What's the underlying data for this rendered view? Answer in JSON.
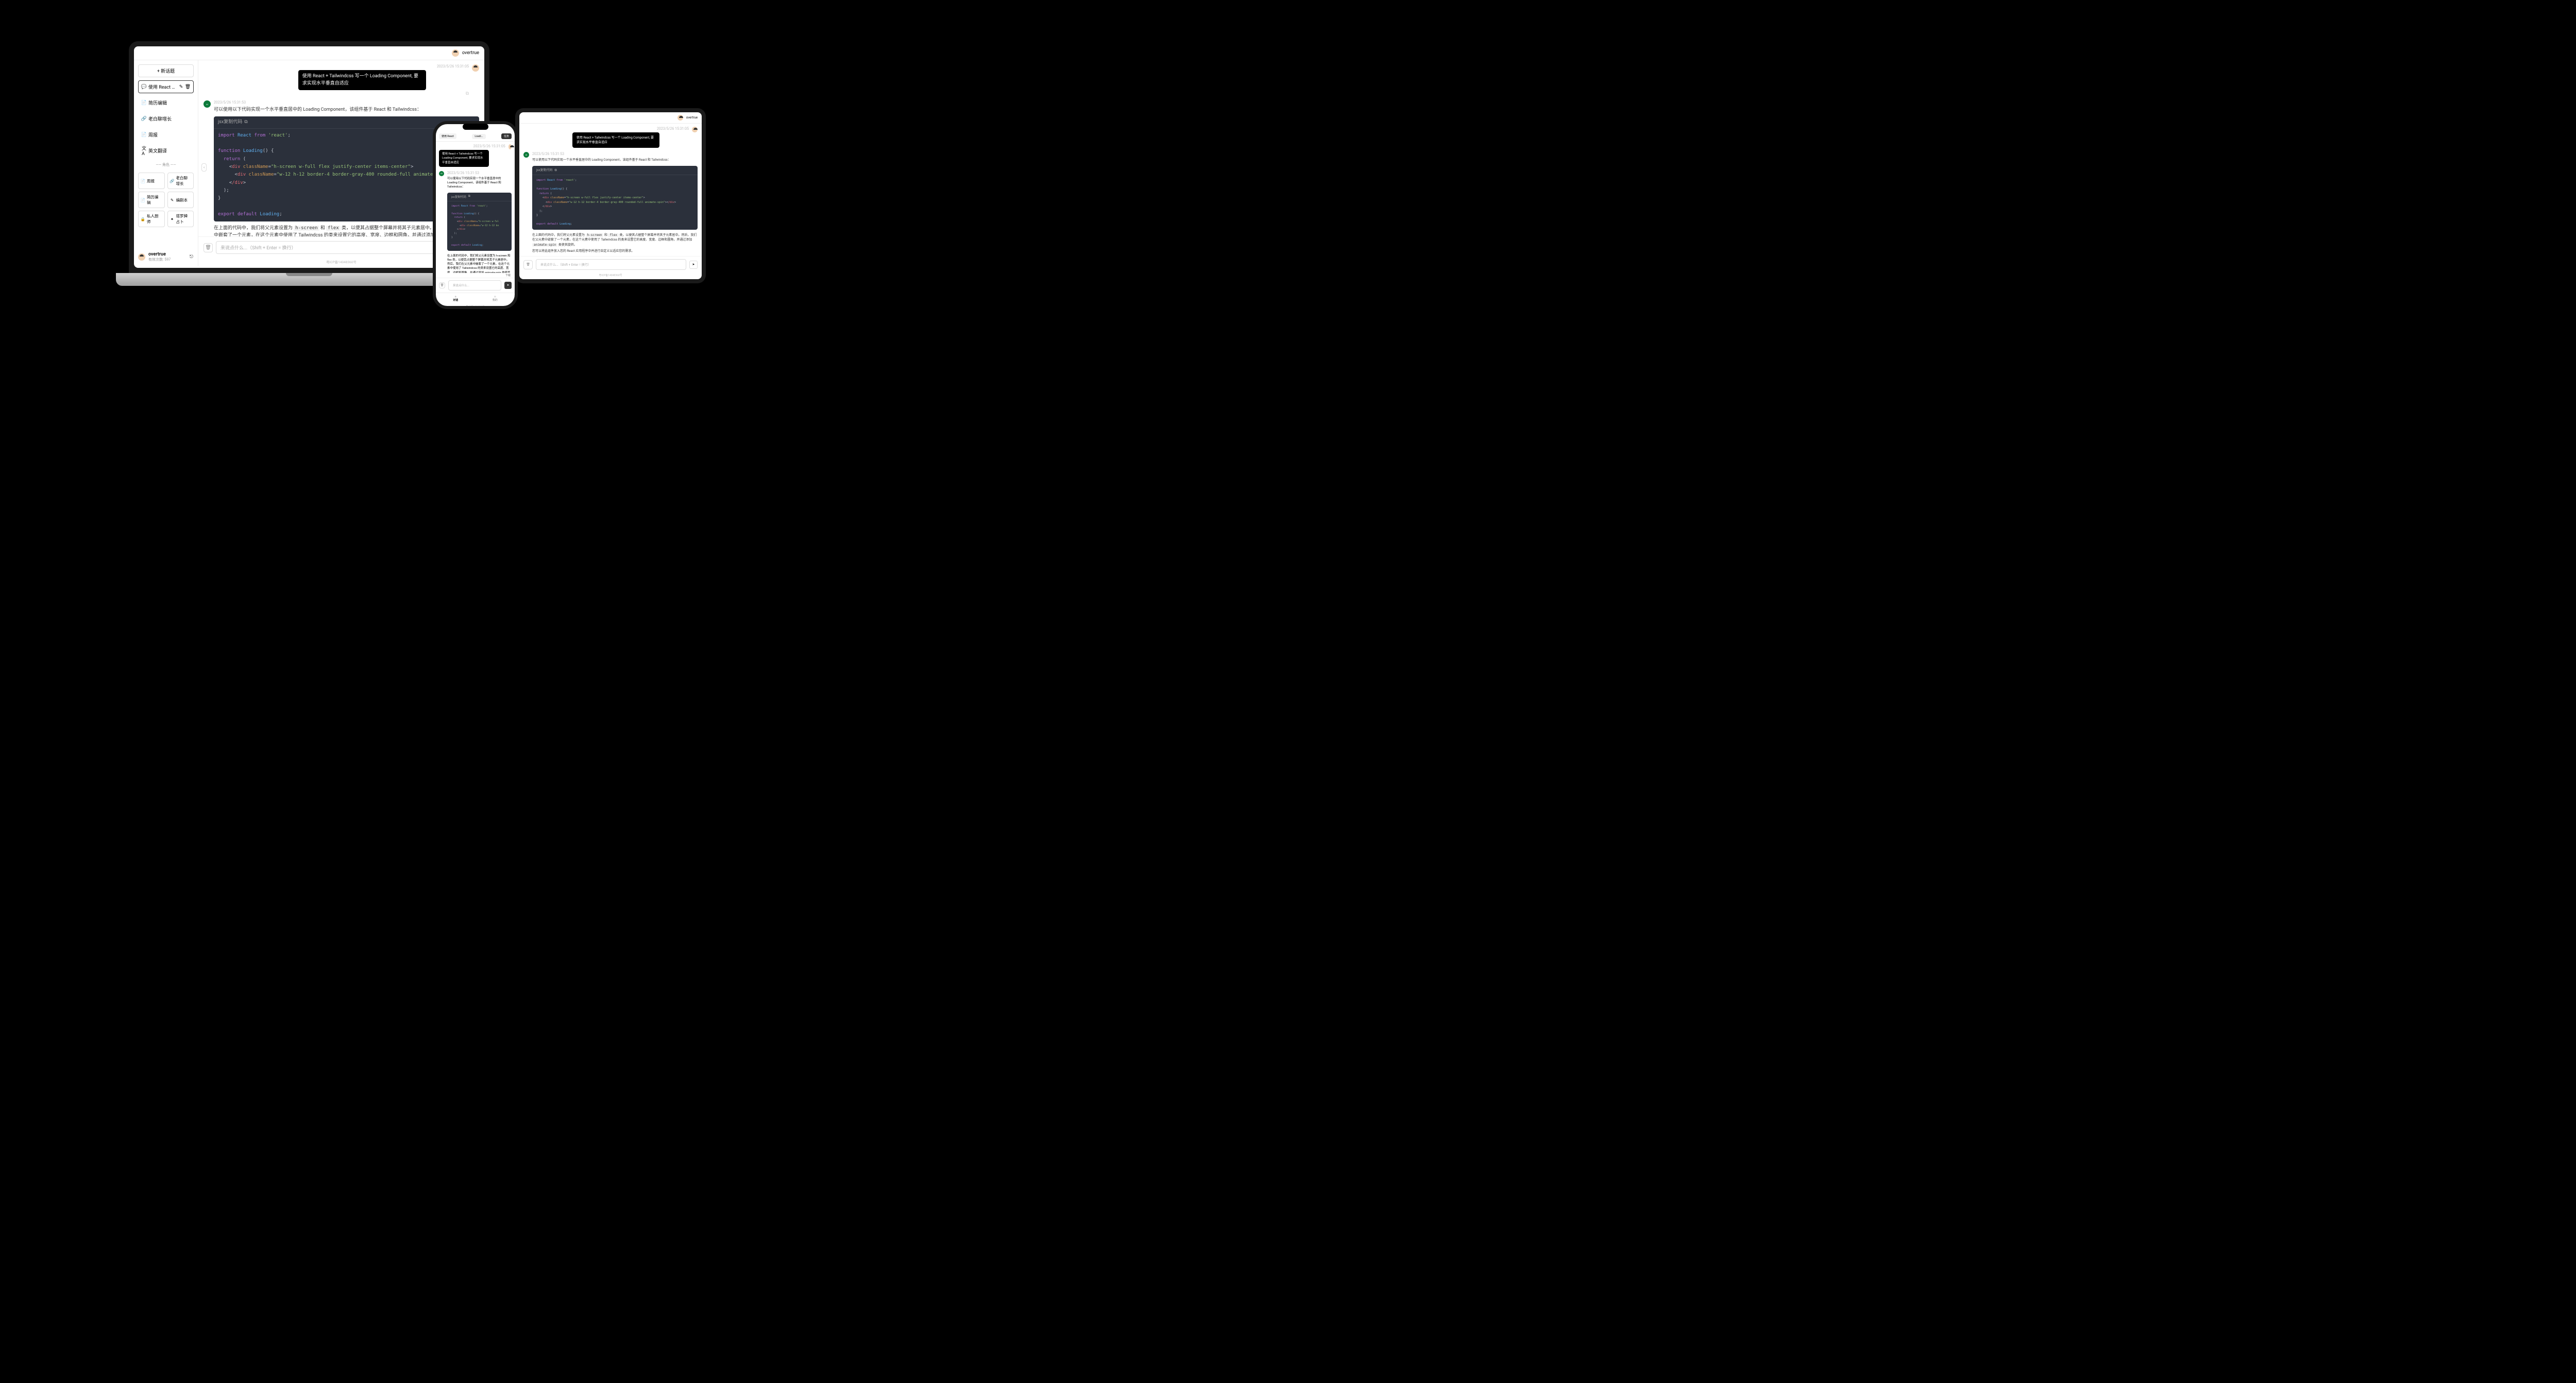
{
  "username": "overtrue",
  "sidebar": {
    "new_topic": "+ 新话题",
    "topics": [
      {
        "icon": "chat",
        "label": "使用 React + Tailwi...",
        "active": true
      },
      {
        "icon": "doc",
        "label": "简历编辑",
        "active": false
      },
      {
        "icon": "link",
        "label": "老白聊增长",
        "active": false
      },
      {
        "icon": "doc",
        "label": "周报",
        "active": false
      },
      {
        "icon": "lang",
        "label": "英文翻译",
        "active": false
      }
    ],
    "section_label": "—— 角色 ——",
    "roles": [
      {
        "icon": "doc",
        "label": "周报"
      },
      {
        "icon": "link",
        "label": "老白聊增长"
      },
      {
        "icon": "doc",
        "label": "简历编辑"
      },
      {
        "icon": "edit",
        "label": "编剧本"
      },
      {
        "icon": "lock",
        "label": "私人厨师"
      },
      {
        "icon": "star",
        "label": "塔罗牌占卜"
      }
    ],
    "footer_sub": "有效次数: 597"
  },
  "chat": {
    "user_ts": "2023/5/26 15:31:05",
    "user_msg": "使用 React + Tailwindcss 写一个 Loading Component, 要求实现水平垂直自适应",
    "bot_ts": "2023/5/26 15:31:53",
    "bot_intro": "可以使用以下代码实现一个水平垂直居中的 Loading Component，该组件基于 React 和 Tailwindcss：",
    "code_lang": "jsx复制代码",
    "code_lines": {
      "l1a": "import",
      "l1b": "React",
      "l1c": "from",
      "l1d": "'react'",
      "l1e": ";",
      "l2a": "function",
      "l2b": "Loading",
      "l2c": "() {",
      "l3a": "return",
      "l3b": "(",
      "l4a": "<",
      "l4b": "div",
      "l4c": "className",
      "l4d": "=",
      "l4e": "\"h-screen w-full flex justify-center items-center\"",
      "l4f": ">",
      "l5a": "<",
      "l5b": "div",
      "l5c": "className",
      "l5d": "=",
      "l5e": "\"w-12 h-12 border-4 border-gray-400 rounded-full animate-spin\"",
      "l5f": "><",
      "l5g": "/div",
      "l5h": ">",
      "l6a": "<",
      "l6b": "/div",
      "l6c": ">",
      "l7": ");",
      "l8": "}",
      "l9a": "export",
      "l9b": "default",
      "l9c": "Loading",
      "l9d": ";"
    },
    "bot_p2_a": "在上面的代码中，我们将父元素设置为 ",
    "bot_p2_code1": "h-screen",
    "bot_p2_b": " 和 ",
    "bot_p2_code2": "flex",
    "bot_p2_c": " 类，以便其占据整个屏幕并将其子元素居中。然后，我们在父元素中嵌套了一个元素，在这个元素中使用了 Tailwindcss 的类来设置它的高度、宽度、边框和圆角，并通过添加 ",
    "bot_p2_code3": "animate-spin",
    "bot_p2_d": " 类使其旋转。",
    "bot_p3": "您可以将此组件放入您的 React 应用程序中并进行自定义以适应您的需求。"
  },
  "input": {
    "placeholder": "来说点什么...（Shift + Enter = 换行）"
  },
  "footer_icp": "粤ICP备14048360号",
  "phone": {
    "tab_left": "使用 React",
    "tab_right": "Loadi...",
    "task_badge": "任务",
    "bot_ts": "2023/5/26 15:31:53",
    "bot_intro_wrap": "可以使用以下代码实现一个水平垂直居中的 Loading Component，该组件基于 React 和 Tailwindcss：",
    "p2_wrap": "在上面的代码中，我们将父元素设置为 h-screen 和 flex 类，以便其占据整个屏幕并将其子元素居中。然后，我们在父元素中嵌套了一个元素，在这个元素中使用了 Tailwindcss 的类来设置它的高度、宽度、边框和圆角，并通过添加 animate-spin 类使其旋转。",
    "download": "下载",
    "nav_chat": "对话",
    "nav_me": "我的",
    "input_ph": "来说点什么..."
  }
}
